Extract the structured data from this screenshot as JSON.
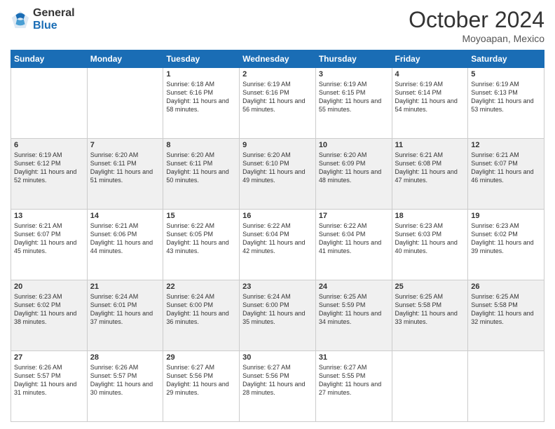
{
  "header": {
    "logo_general": "General",
    "logo_blue": "Blue",
    "month_title": "October 2024",
    "subtitle": "Moyoapan, Mexico"
  },
  "days_of_week": [
    "Sunday",
    "Monday",
    "Tuesday",
    "Wednesday",
    "Thursday",
    "Friday",
    "Saturday"
  ],
  "weeks": [
    [
      {
        "day": "",
        "sunrise": "",
        "sunset": "",
        "daylight": ""
      },
      {
        "day": "",
        "sunrise": "",
        "sunset": "",
        "daylight": ""
      },
      {
        "day": "1",
        "sunrise": "Sunrise: 6:18 AM",
        "sunset": "Sunset: 6:16 PM",
        "daylight": "Daylight: 11 hours and 58 minutes."
      },
      {
        "day": "2",
        "sunrise": "Sunrise: 6:19 AM",
        "sunset": "Sunset: 6:16 PM",
        "daylight": "Daylight: 11 hours and 56 minutes."
      },
      {
        "day": "3",
        "sunrise": "Sunrise: 6:19 AM",
        "sunset": "Sunset: 6:15 PM",
        "daylight": "Daylight: 11 hours and 55 minutes."
      },
      {
        "day": "4",
        "sunrise": "Sunrise: 6:19 AM",
        "sunset": "Sunset: 6:14 PM",
        "daylight": "Daylight: 11 hours and 54 minutes."
      },
      {
        "day": "5",
        "sunrise": "Sunrise: 6:19 AM",
        "sunset": "Sunset: 6:13 PM",
        "daylight": "Daylight: 11 hours and 53 minutes."
      }
    ],
    [
      {
        "day": "6",
        "sunrise": "Sunrise: 6:19 AM",
        "sunset": "Sunset: 6:12 PM",
        "daylight": "Daylight: 11 hours and 52 minutes."
      },
      {
        "day": "7",
        "sunrise": "Sunrise: 6:20 AM",
        "sunset": "Sunset: 6:11 PM",
        "daylight": "Daylight: 11 hours and 51 minutes."
      },
      {
        "day": "8",
        "sunrise": "Sunrise: 6:20 AM",
        "sunset": "Sunset: 6:11 PM",
        "daylight": "Daylight: 11 hours and 50 minutes."
      },
      {
        "day": "9",
        "sunrise": "Sunrise: 6:20 AM",
        "sunset": "Sunset: 6:10 PM",
        "daylight": "Daylight: 11 hours and 49 minutes."
      },
      {
        "day": "10",
        "sunrise": "Sunrise: 6:20 AM",
        "sunset": "Sunset: 6:09 PM",
        "daylight": "Daylight: 11 hours and 48 minutes."
      },
      {
        "day": "11",
        "sunrise": "Sunrise: 6:21 AM",
        "sunset": "Sunset: 6:08 PM",
        "daylight": "Daylight: 11 hours and 47 minutes."
      },
      {
        "day": "12",
        "sunrise": "Sunrise: 6:21 AM",
        "sunset": "Sunset: 6:07 PM",
        "daylight": "Daylight: 11 hours and 46 minutes."
      }
    ],
    [
      {
        "day": "13",
        "sunrise": "Sunrise: 6:21 AM",
        "sunset": "Sunset: 6:07 PM",
        "daylight": "Daylight: 11 hours and 45 minutes."
      },
      {
        "day": "14",
        "sunrise": "Sunrise: 6:21 AM",
        "sunset": "Sunset: 6:06 PM",
        "daylight": "Daylight: 11 hours and 44 minutes."
      },
      {
        "day": "15",
        "sunrise": "Sunrise: 6:22 AM",
        "sunset": "Sunset: 6:05 PM",
        "daylight": "Daylight: 11 hours and 43 minutes."
      },
      {
        "day": "16",
        "sunrise": "Sunrise: 6:22 AM",
        "sunset": "Sunset: 6:04 PM",
        "daylight": "Daylight: 11 hours and 42 minutes."
      },
      {
        "day": "17",
        "sunrise": "Sunrise: 6:22 AM",
        "sunset": "Sunset: 6:04 PM",
        "daylight": "Daylight: 11 hours and 41 minutes."
      },
      {
        "day": "18",
        "sunrise": "Sunrise: 6:23 AM",
        "sunset": "Sunset: 6:03 PM",
        "daylight": "Daylight: 11 hours and 40 minutes."
      },
      {
        "day": "19",
        "sunrise": "Sunrise: 6:23 AM",
        "sunset": "Sunset: 6:02 PM",
        "daylight": "Daylight: 11 hours and 39 minutes."
      }
    ],
    [
      {
        "day": "20",
        "sunrise": "Sunrise: 6:23 AM",
        "sunset": "Sunset: 6:02 PM",
        "daylight": "Daylight: 11 hours and 38 minutes."
      },
      {
        "day": "21",
        "sunrise": "Sunrise: 6:24 AM",
        "sunset": "Sunset: 6:01 PM",
        "daylight": "Daylight: 11 hours and 37 minutes."
      },
      {
        "day": "22",
        "sunrise": "Sunrise: 6:24 AM",
        "sunset": "Sunset: 6:00 PM",
        "daylight": "Daylight: 11 hours and 36 minutes."
      },
      {
        "day": "23",
        "sunrise": "Sunrise: 6:24 AM",
        "sunset": "Sunset: 6:00 PM",
        "daylight": "Daylight: 11 hours and 35 minutes."
      },
      {
        "day": "24",
        "sunrise": "Sunrise: 6:25 AM",
        "sunset": "Sunset: 5:59 PM",
        "daylight": "Daylight: 11 hours and 34 minutes."
      },
      {
        "day": "25",
        "sunrise": "Sunrise: 6:25 AM",
        "sunset": "Sunset: 5:58 PM",
        "daylight": "Daylight: 11 hours and 33 minutes."
      },
      {
        "day": "26",
        "sunrise": "Sunrise: 6:25 AM",
        "sunset": "Sunset: 5:58 PM",
        "daylight": "Daylight: 11 hours and 32 minutes."
      }
    ],
    [
      {
        "day": "27",
        "sunrise": "Sunrise: 6:26 AM",
        "sunset": "Sunset: 5:57 PM",
        "daylight": "Daylight: 11 hours and 31 minutes."
      },
      {
        "day": "28",
        "sunrise": "Sunrise: 6:26 AM",
        "sunset": "Sunset: 5:57 PM",
        "daylight": "Daylight: 11 hours and 30 minutes."
      },
      {
        "day": "29",
        "sunrise": "Sunrise: 6:27 AM",
        "sunset": "Sunset: 5:56 PM",
        "daylight": "Daylight: 11 hours and 29 minutes."
      },
      {
        "day": "30",
        "sunrise": "Sunrise: 6:27 AM",
        "sunset": "Sunset: 5:56 PM",
        "daylight": "Daylight: 11 hours and 28 minutes."
      },
      {
        "day": "31",
        "sunrise": "Sunrise: 6:27 AM",
        "sunset": "Sunset: 5:55 PM",
        "daylight": "Daylight: 11 hours and 27 minutes."
      },
      {
        "day": "",
        "sunrise": "",
        "sunset": "",
        "daylight": ""
      },
      {
        "day": "",
        "sunrise": "",
        "sunset": "",
        "daylight": ""
      }
    ]
  ]
}
